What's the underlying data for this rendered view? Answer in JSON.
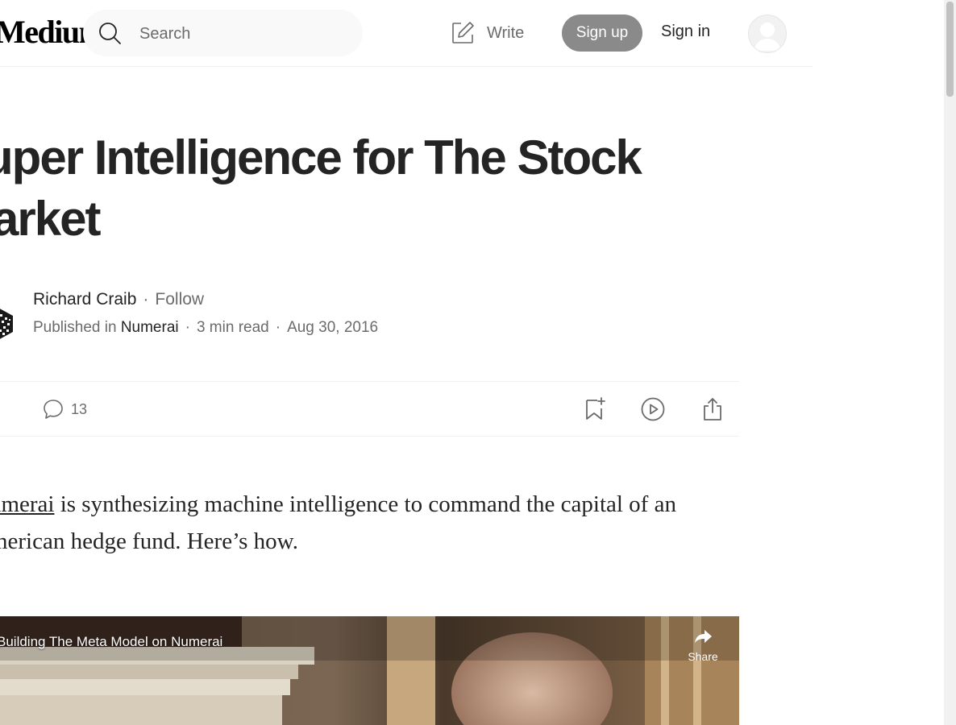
{
  "header": {
    "logo": "Medium",
    "search_placeholder": "Search",
    "write_label": "Write",
    "signup_label": "Sign up",
    "signin_label": "Sign in"
  },
  "article": {
    "title": "Super Intelligence for The Stock Market",
    "author": "Richard Craib",
    "follow_label": "Follow",
    "published_prefix": "Published in",
    "publication": "Numerai",
    "read_time": "3 min read",
    "date": "Aug 30, 2016",
    "separator": "·",
    "responses_count": "13",
    "lead_link": "Numerai",
    "lead_text": " is synthesizing machine intelligence to command the capital of an American hedge fund. Here’s how."
  },
  "video": {
    "title": "Building The Meta Model on Numerai",
    "share_label": "Share"
  },
  "colors": {
    "text": "#242424",
    "muted": "#6b6b6b",
    "signup_bg": "#8a8a8a",
    "search_bg": "#f9f9f9"
  },
  "icons": [
    "search-icon",
    "write-icon",
    "avatar-icon",
    "response-icon",
    "bookmark-icon",
    "play-icon",
    "share-icon"
  ]
}
